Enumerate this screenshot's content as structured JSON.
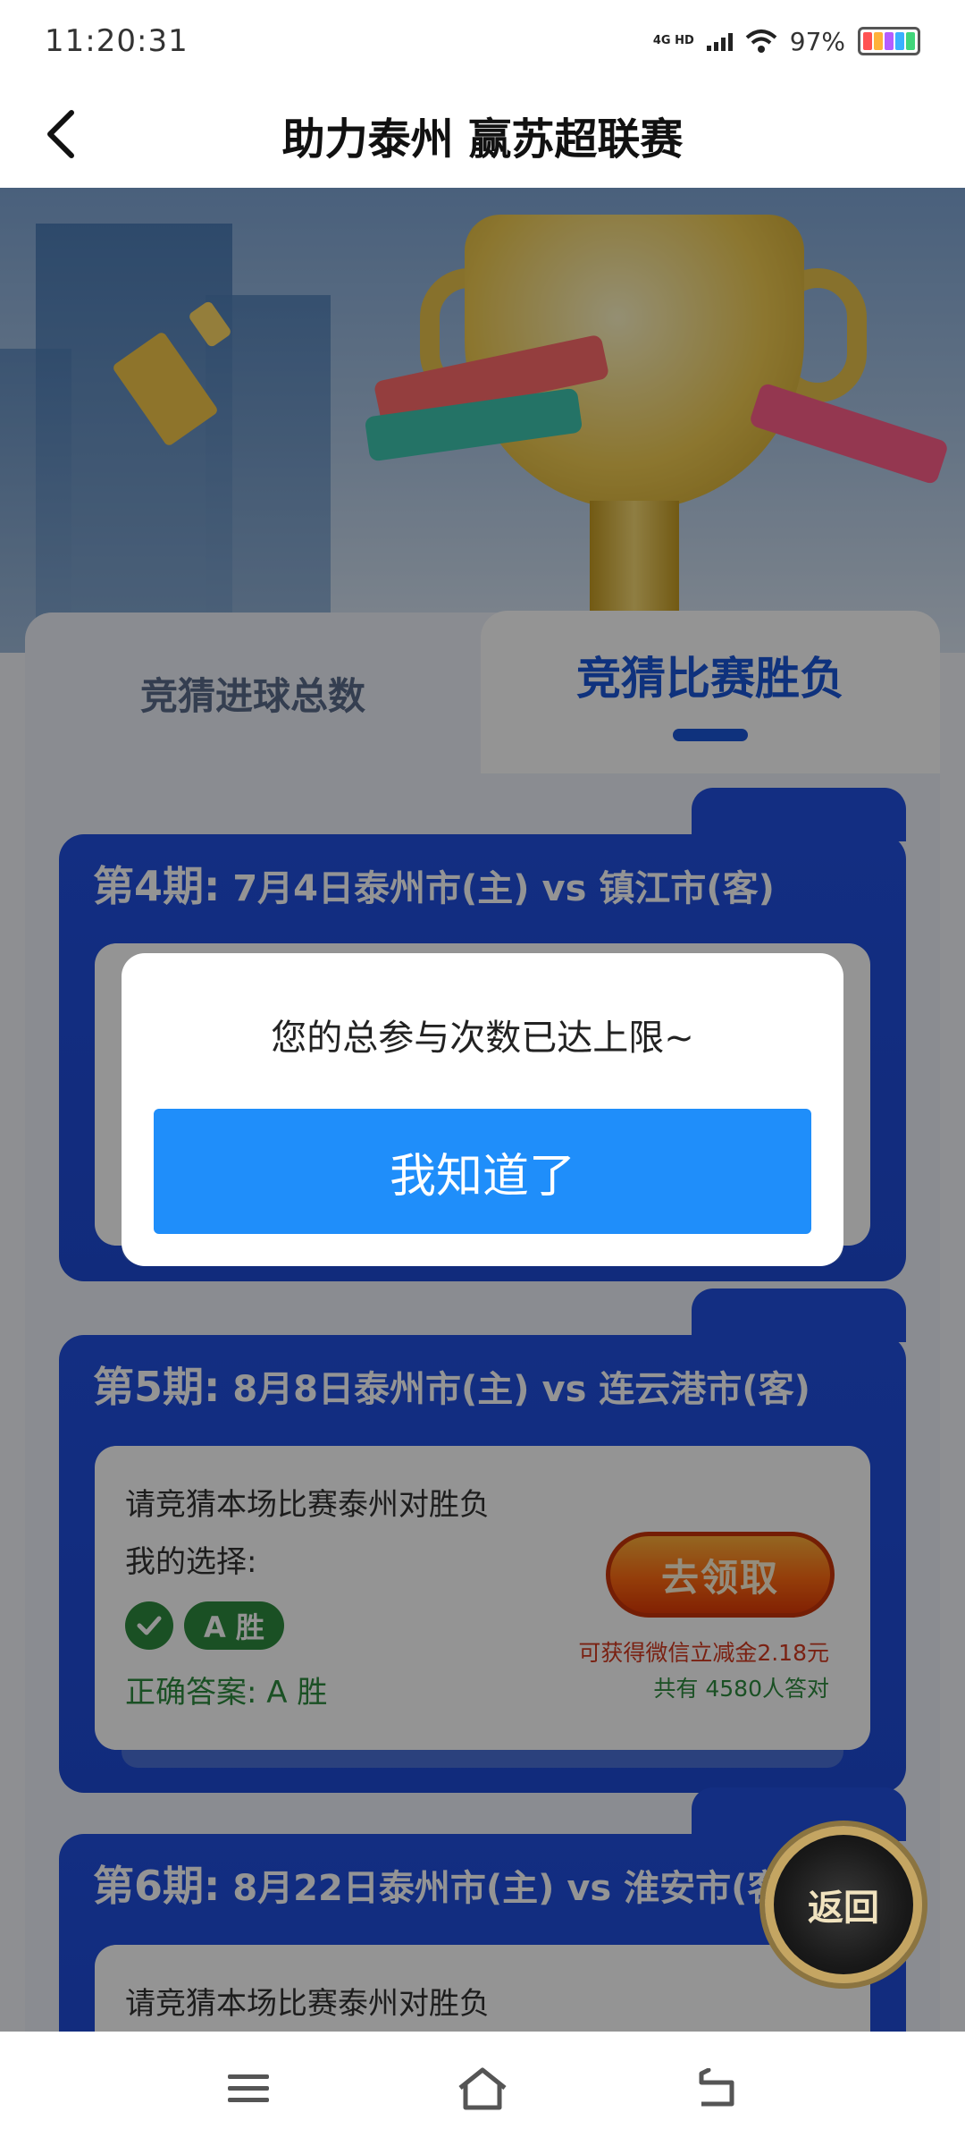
{
  "status_bar": {
    "time": "11:20:31",
    "network": "4G HD",
    "battery": "97%"
  },
  "header": {
    "title": "助力泰州 赢苏超联赛"
  },
  "tabs": [
    {
      "label": "竞猜进球总数",
      "active": false
    },
    {
      "label": "竞猜比赛胜负",
      "active": true
    }
  ],
  "periods": [
    {
      "number": "第4期:",
      "match": "7月4日泰州市(主) vs 镇江市(客)"
    },
    {
      "number": "第5期:",
      "match": "8月8日泰州市(主) vs 连云港市(客)",
      "question": "请竞猜本场比赛泰州对胜负",
      "my_choice_label": "我的选择:",
      "my_choice": "A 胜",
      "correct_answer": "正确答案: A 胜",
      "claim_button": "去领取",
      "reward": "可获得微信立减金2.18元",
      "correct_count": "共有 4580人答对"
    },
    {
      "number": "第6期:",
      "match": "8月22日泰州市(主) vs 淮安市(客)",
      "question": "请竞猜本场比赛泰州对胜负"
    }
  ],
  "float_button": {
    "label": "返回"
  },
  "modal": {
    "message": "您的总参与次数已达上限~",
    "button": "我知道了"
  },
  "nav_bar": {
    "icons": [
      "menu-icon",
      "home-icon",
      "back-icon"
    ]
  },
  "colors": {
    "primary_blue": "#1a56d8",
    "modal_button": "#1f8efa",
    "success_green": "#2e8b3e",
    "reward_red": "#d23a20"
  }
}
